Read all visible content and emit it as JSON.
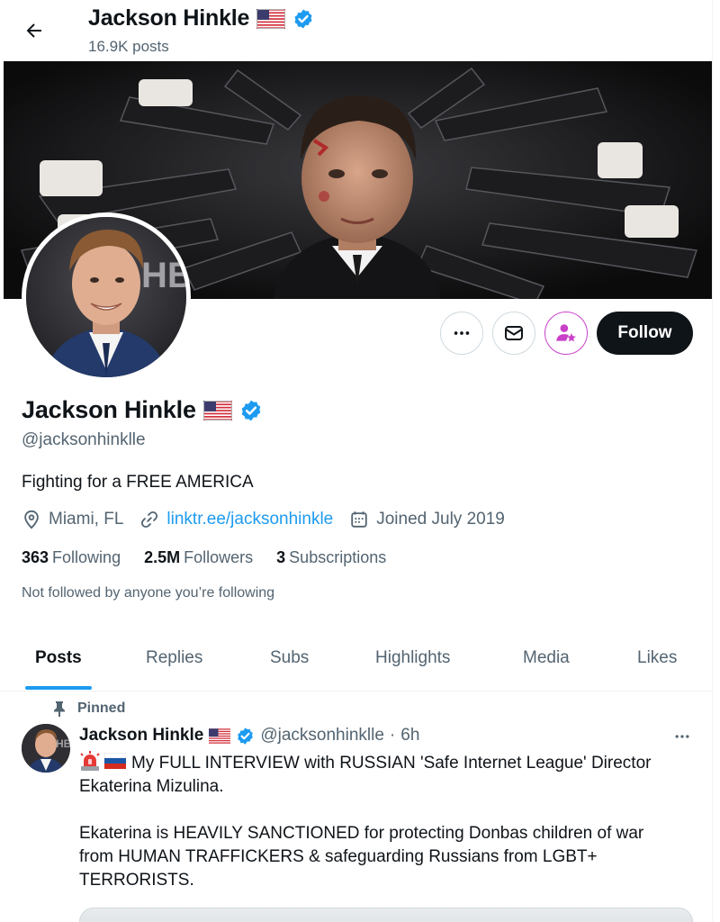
{
  "header": {
    "name": "Jackson Hinkle",
    "posts_count": "16.9K posts"
  },
  "profile": {
    "name": "Jackson Hinkle",
    "handle": "@jacksonhinklle",
    "bio": "Fighting for a FREE AMERICA",
    "location": "Miami, FL",
    "link": "linktr.ee/jacksonhinkle",
    "joined": "Joined July 2019",
    "following_count": "363",
    "following_label": "Following",
    "followers_count": "2.5M",
    "followers_label": "Followers",
    "subscriptions_count": "3",
    "subscriptions_label": "Subscriptions",
    "not_followed_text": "Not followed by anyone you’re following"
  },
  "actions": {
    "follow_label": "Follow"
  },
  "tabs": [
    {
      "label": "Posts",
      "active": true
    },
    {
      "label": "Replies",
      "active": false
    },
    {
      "label": "Subs",
      "active": false
    },
    {
      "label": "Highlights",
      "active": false
    },
    {
      "label": "Media",
      "active": false
    },
    {
      "label": "Likes",
      "active": false
    }
  ],
  "post": {
    "pinned_label": "Pinned",
    "author_name": "Jackson Hinkle",
    "author_handle": "@jacksonhinklle",
    "separator": "·",
    "time": "6h",
    "line1": "My FULL INTERVIEW with RUSSIAN 'Safe Internet League' Director",
    "line2": "Ekaterina Mizulina.",
    "line3": "Ekaterina is HEAVILY SANCTIONED for protecting Donbas children of war",
    "line4": "from HUMAN TRAFFICKERS & safeguarding Russians from LGBT+",
    "line5": "TERRORISTS."
  },
  "colors": {
    "accent": "#1d9bf0",
    "text_primary": "#0f1419",
    "text_secondary": "#536471",
    "subscribe_accent": "#c940c9",
    "follow_bg": "#0f1419"
  },
  "icons": {
    "back": "arrow-left-icon",
    "flag": "us-flag-icon",
    "verified": "verified-badge-icon",
    "more": "more-horizontal-icon",
    "message": "envelope-icon",
    "subscribe": "subscribe-star-person-icon",
    "location": "location-pin-icon",
    "link": "link-icon",
    "calendar": "calendar-icon",
    "pin": "pin-icon",
    "siren": "siren-emoji-icon",
    "russian_flag": "russia-flag-icon"
  }
}
